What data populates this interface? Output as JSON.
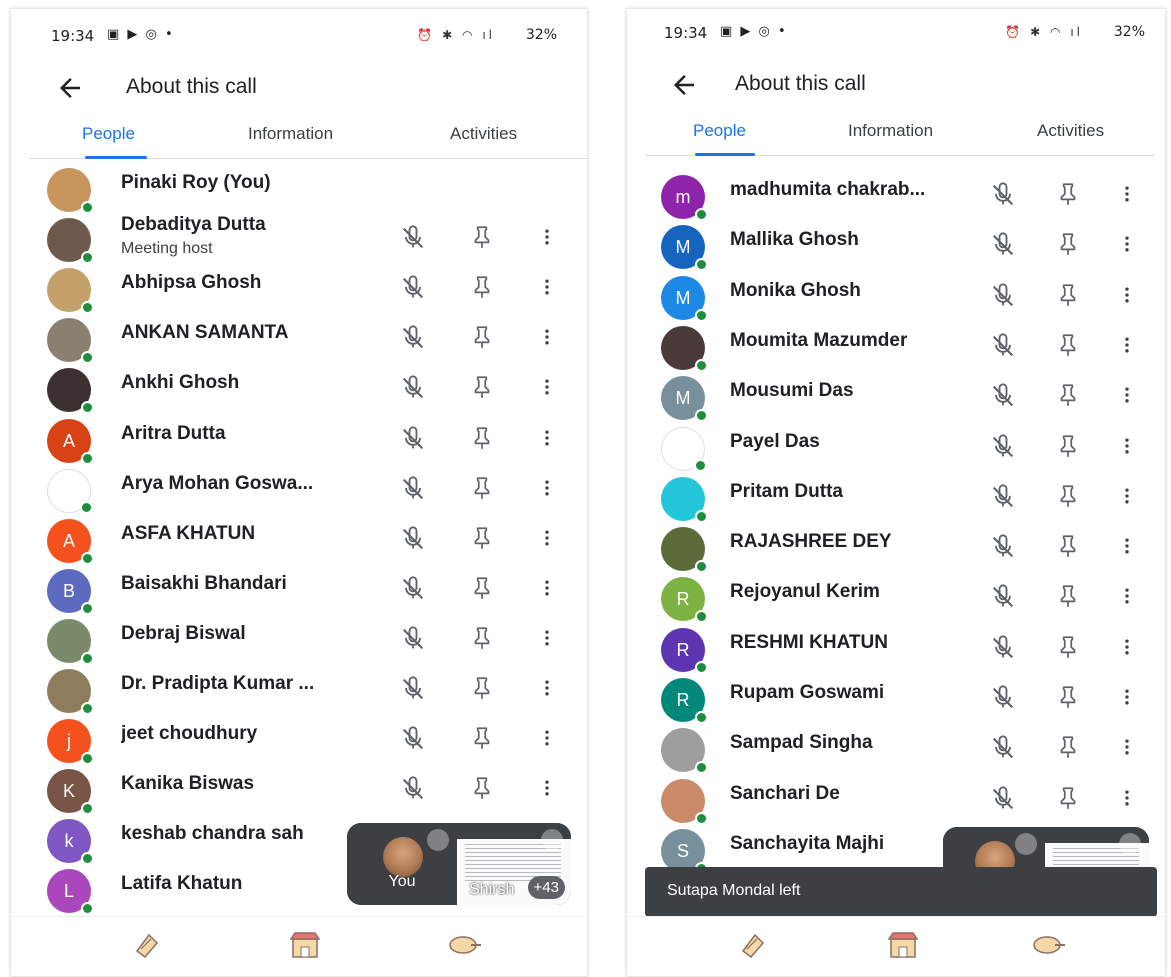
{
  "status": {
    "time": "19:34",
    "battery": "32%",
    "notification_icons": [
      "image-icon",
      "youtube-icon",
      "whatsapp-icon",
      "dot-icon"
    ],
    "system_icons": [
      "alarm-icon",
      "bluetooth-icon",
      "wifi-icon",
      "volte-icon",
      "signal-icon",
      "battery-icon"
    ]
  },
  "header": {
    "title": "About this call"
  },
  "tabs": [
    {
      "label": "People",
      "active": true
    },
    {
      "label": "Information",
      "active": false
    },
    {
      "label": "Activities",
      "active": false
    }
  ],
  "left_screen": {
    "participants": [
      {
        "name": "Pinaki Roy (You)",
        "avatar_color": "#c8955f",
        "avatar_letter": ""
      },
      {
        "name": "Debaditya Dutta",
        "subtitle": "Meeting host",
        "avatar_color": "#6d5a4d",
        "avatar_letter": ""
      },
      {
        "name": "Abhipsa Ghosh",
        "avatar_color": "#c4a16b",
        "avatar_letter": ""
      },
      {
        "name": "ANKAN SAMANTA",
        "avatar_color": "#8a8070",
        "avatar_letter": ""
      },
      {
        "name": "Ankhi Ghosh",
        "avatar_color": "#3c3030",
        "avatar_letter": ""
      },
      {
        "name": "Aritra Dutta",
        "avatar_color": "#d84315",
        "avatar_letter": "A"
      },
      {
        "name": "Arya Mohan Goswa...",
        "avatar_color": "#ffffff",
        "avatar_letter": ""
      },
      {
        "name": "ASFA KHATUN",
        "avatar_color": "#f4511e",
        "avatar_letter": "A"
      },
      {
        "name": "Baisakhi Bhandari",
        "avatar_color": "#5c6bc0",
        "avatar_letter": "B"
      },
      {
        "name": "Debraj Biswal",
        "avatar_color": "#7a8a6a",
        "avatar_letter": ""
      },
      {
        "name": "Dr. Pradipta Kumar ...",
        "avatar_color": "#8d7d5d",
        "avatar_letter": ""
      },
      {
        "name": "jeet choudhury",
        "avatar_color": "#f4511e",
        "avatar_letter": "j"
      },
      {
        "name": "Kanika Biswas",
        "avatar_color": "#795548",
        "avatar_letter": "K"
      },
      {
        "name": "keshab chandra sah",
        "avatar_color": "#7e57c2",
        "avatar_letter": "k"
      },
      {
        "name": "Latifa Khatun",
        "avatar_color": "#ab47bc",
        "avatar_letter": "L"
      }
    ],
    "pip": {
      "self_label": "You",
      "screen_owner": "Shirsh",
      "more_count": "+43"
    }
  },
  "right_screen": {
    "participants": [
      {
        "name": "madhumita chakrab...",
        "avatar_color": "#8e24aa",
        "avatar_letter": "m"
      },
      {
        "name": "Mallika Ghosh",
        "avatar_color": "#1565c0",
        "avatar_letter": "M"
      },
      {
        "name": "Monika Ghosh",
        "avatar_color": "#1e88e5",
        "avatar_letter": "M"
      },
      {
        "name": "Moumita Mazumder",
        "avatar_color": "#4a3a3a",
        "avatar_letter": ""
      },
      {
        "name": "Mousumi Das",
        "avatar_color": "#78909c",
        "avatar_letter": "M"
      },
      {
        "name": "Payel Das",
        "avatar_color": "#ffffff",
        "avatar_letter": ""
      },
      {
        "name": "Pritam Dutta",
        "avatar_color": "#26c6da",
        "avatar_letter": ""
      },
      {
        "name": "RAJASHREE DEY",
        "avatar_color": "#5d6a3a",
        "avatar_letter": ""
      },
      {
        "name": "Rejoyanul Kerim",
        "avatar_color": "#7cb342",
        "avatar_letter": "R"
      },
      {
        "name": "RESHMI KHATUN",
        "avatar_color": "#5e35b1",
        "avatar_letter": "R"
      },
      {
        "name": "Rupam Goswami",
        "avatar_color": "#00897b",
        "avatar_letter": "R"
      },
      {
        "name": "Sampad Singha",
        "avatar_color": "#9e9e9e",
        "avatar_letter": ""
      },
      {
        "name": "Sanchari De",
        "avatar_color": "#c98a6a",
        "avatar_letter": ""
      },
      {
        "name": "Sanchayita Majhi",
        "avatar_color": "#78909c",
        "avatar_letter": "S"
      }
    ],
    "snackbar": "Sutapa Mondal left"
  },
  "bottom_nav": [
    {
      "icon": "reaction-icon"
    },
    {
      "icon": "activities-icon"
    },
    {
      "icon": "present-icon"
    }
  ],
  "colors": {
    "accent": "#1a73e8",
    "online": "#1e8e3e"
  }
}
